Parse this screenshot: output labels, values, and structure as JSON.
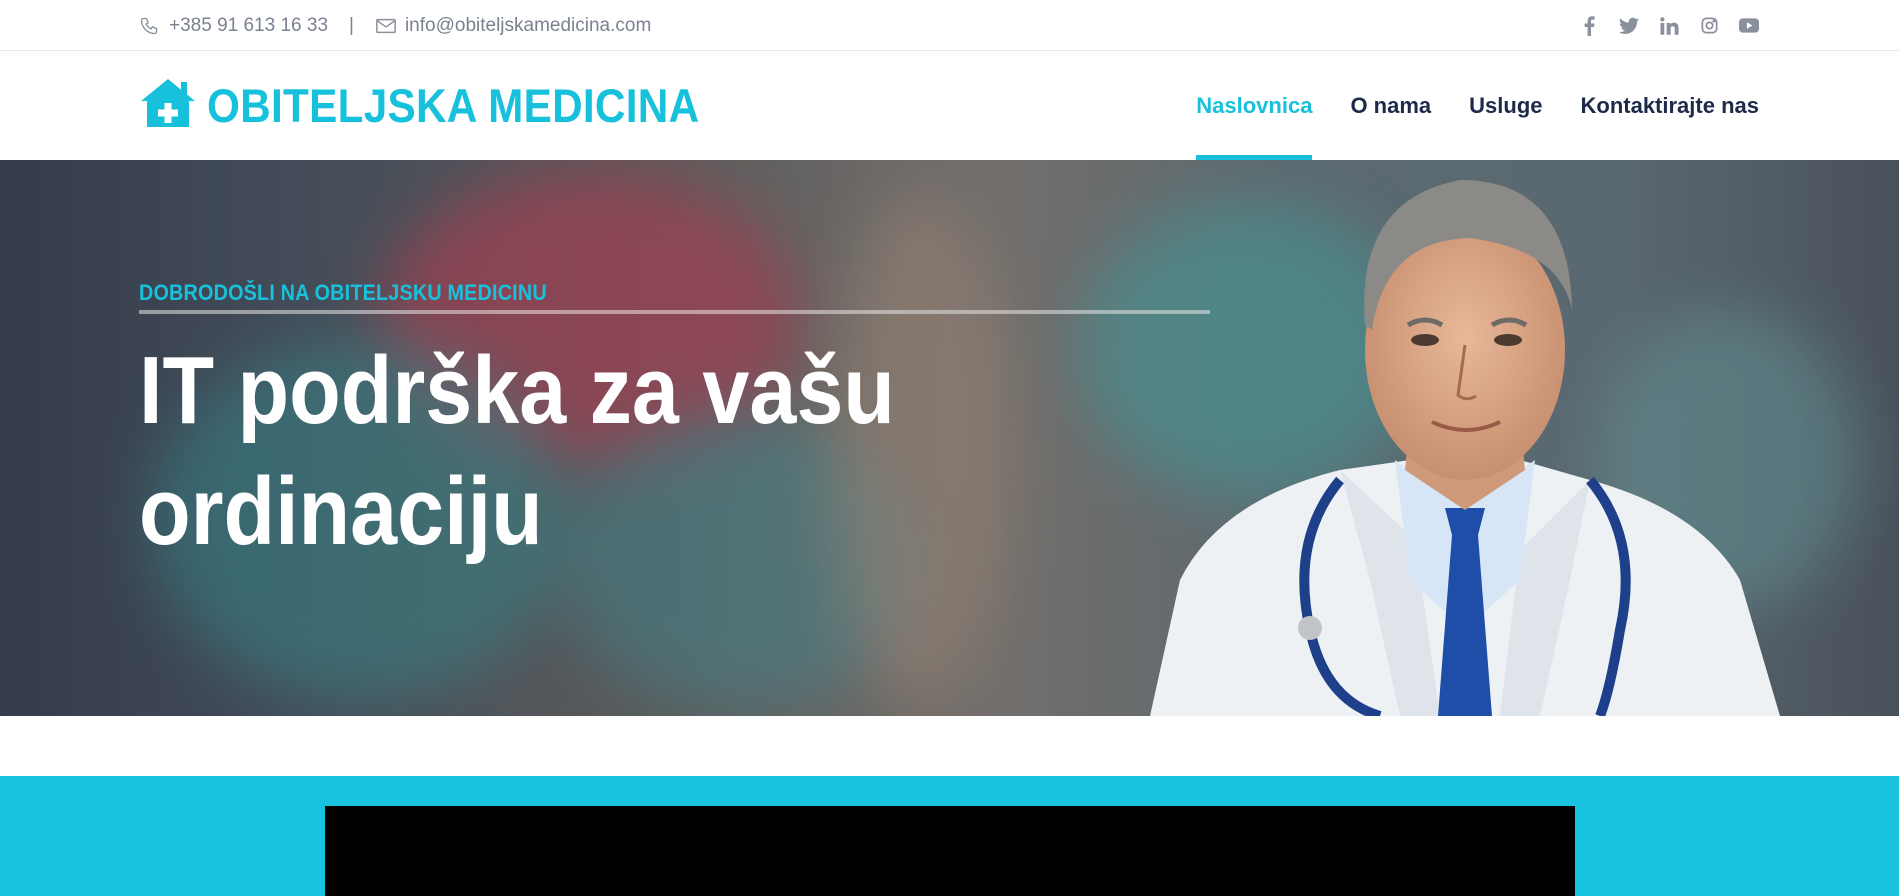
{
  "topbar": {
    "phone": "+385 91 613 16 33",
    "separator": "|",
    "email": "info@obiteljskamedicina.com",
    "social": [
      "facebook-icon",
      "twitter-icon",
      "linkedin-icon",
      "instagram-icon",
      "youtube-icon"
    ]
  },
  "header": {
    "logo_text": "OBITELJSKA MEDICINA",
    "nav": [
      {
        "label": "Naslovnica",
        "active": true
      },
      {
        "label": "O nama",
        "active": false
      },
      {
        "label": "Usluge",
        "active": false
      },
      {
        "label": "Kontaktirajte nas",
        "active": false
      }
    ]
  },
  "hero": {
    "eyebrow": "DOBRODOŠLI NA OBITELJSKU MEDICINU",
    "headline": "IT podrška za vašu ordinaciju"
  },
  "colors": {
    "accent": "#17c1dc",
    "nav_text": "#1d2a4a",
    "muted": "#7a8290"
  }
}
